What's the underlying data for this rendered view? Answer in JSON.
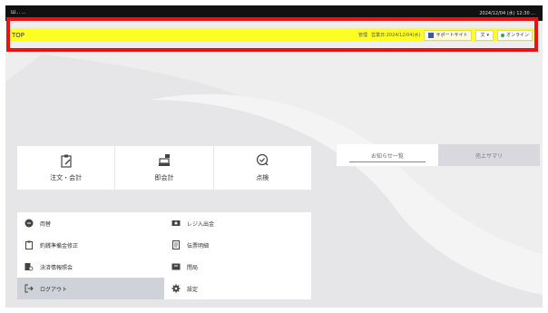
{
  "topbar": {
    "left_text": "Ш... ...",
    "right_text": "2024/12/04 (水) 12:30 ..."
  },
  "header": {
    "title": "TOP",
    "user": "管理",
    "business_date": "営業日:2024/12/04(水)",
    "support_label": "サポートサイト",
    "language_label": "文",
    "status_label": "オンライン",
    "status_color": "#2aaa55"
  },
  "menu": {
    "buttons": [
      {
        "label": "注文・会計",
        "icon": "clipboard-edit-icon"
      },
      {
        "label": "即会計",
        "icon": "cash-register-icon"
      },
      {
        "label": "点検",
        "icon": "check-circle-icon"
      }
    ]
  },
  "list": {
    "items": [
      {
        "label": "両替",
        "icon": "exchange-icon"
      },
      {
        "label": "レジ入出金",
        "icon": "cash-icon"
      },
      {
        "label": "釣銭準備金修正",
        "icon": "clipboard-icon"
      },
      {
        "label": "伝票明細",
        "icon": "receipt-icon"
      },
      {
        "label": "決済情報照会",
        "icon": "payment-search-icon"
      },
      {
        "label": "閉局",
        "icon": "close-store-icon"
      },
      {
        "label": "ログアウト",
        "icon": "logout-icon"
      },
      {
        "label": "設定",
        "icon": "gear-icon"
      }
    ]
  },
  "tabs": [
    {
      "label": "お知らせ一覧",
      "active": true
    },
    {
      "label": "売上サマリ",
      "active": false
    }
  ],
  "colors": {
    "highlight": "#ee1111",
    "header_bg": "#ffff22"
  }
}
